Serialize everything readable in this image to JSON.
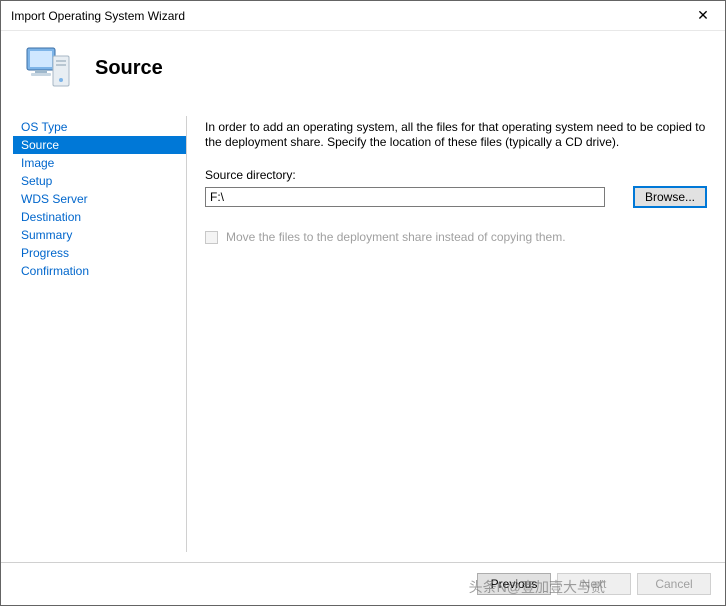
{
  "window": {
    "title": "Import Operating System Wizard",
    "close_glyph": "✕"
  },
  "header": {
    "page_title": "Source"
  },
  "nav": {
    "items": [
      {
        "label": "OS Type",
        "selected": false
      },
      {
        "label": "Source",
        "selected": true
      },
      {
        "label": "Image",
        "selected": false
      },
      {
        "label": "Setup",
        "selected": false
      },
      {
        "label": "WDS Server",
        "selected": false
      },
      {
        "label": "Destination",
        "selected": false
      },
      {
        "label": "Summary",
        "selected": false
      },
      {
        "label": "Progress",
        "selected": false
      },
      {
        "label": "Confirmation",
        "selected": false
      }
    ]
  },
  "content": {
    "intro": "In order to add an operating system, all the files for that operating system need to be copied to the deployment share.  Specify the location of these files (typically a CD drive).",
    "source_label": "Source directory:",
    "source_value": "F:\\",
    "browse_label": "Browse...",
    "move_checkbox_label": "Move the files to the deployment share instead of copying them."
  },
  "footer": {
    "previous": "Previous",
    "next": "Next",
    "cancel": "Cancel"
  },
  "watermark": "头条N@壹加壹大与贰"
}
